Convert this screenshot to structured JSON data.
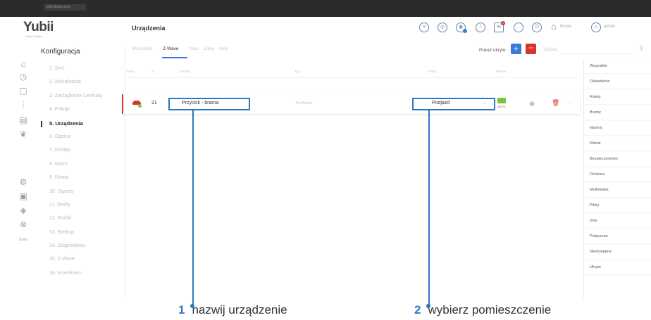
{
  "browser": {
    "url": "skm.fibaro.com"
  },
  "app": {
    "logo": "Yubii",
    "logo_sub": "Home Center",
    "brand_color": "#3a7bd5",
    "danger_color": "#d9342b"
  },
  "sidebar": {
    "title": "Konfiguracja",
    "items": [
      {
        "label": "1. Sieć"
      },
      {
        "label": "2. Aktualizacja"
      },
      {
        "label": "3. Zarządzanie Centralą"
      },
      {
        "label": "4. Pokoje"
      },
      {
        "label": "5. Urządzenia",
        "active": true
      },
      {
        "label": "6. Ogólne"
      },
      {
        "label": "7. Dostęp"
      },
      {
        "label": "8. Alarm"
      },
      {
        "label": "9. Klimat"
      },
      {
        "label": "10. Ogrody"
      },
      {
        "label": "11. Strefy"
      },
      {
        "label": "12. Profile"
      },
      {
        "label": "13. Backup"
      },
      {
        "label": "14. Diagnostyka"
      },
      {
        "label": "15. Z-Wave"
      },
      {
        "label": "16. Incentiveru"
      }
    ],
    "rail_icons": [
      "home-icon",
      "clock-icon",
      "panel-icon",
      "chart-icon",
      "grid-icon",
      "leaf-icon",
      "gear-icon",
      "window-icon",
      "shield-icon",
      "settings-icon",
      "user-icon"
    ],
    "rail_footer": "Szary"
  },
  "header": {
    "title": "Urządzenia",
    "home_label": "Home",
    "user_label": "admin",
    "notification_count": "1"
  },
  "tabs": [
    "Wszystkie",
    "Z-Wave",
    "Nice",
    "Zony",
    "Inne"
  ],
  "toolbar": {
    "show_hidden": "Pokaż ukryte",
    "add_label": "+",
    "delete_label": "−",
    "search_label": "Szukaj"
  },
  "columns": [
    "Ikona",
    "ID",
    "Nazwa",
    "Typ",
    "Pokój",
    "Bateria"
  ],
  "row": {
    "id": "21",
    "name": "Przycisk - brama",
    "type": "The Button",
    "room": "Podjazd",
    "battery": "100 %"
  },
  "filters": [
    "Wszystkie",
    "Oświetlenie",
    "Rolety",
    "Bramy",
    "Nastroj",
    "Klimat",
    "Bezpieczeństwo",
    "Ochrona",
    "Multimedia",
    "Piloty",
    "Inne",
    "Połączone",
    "Niedostępne",
    "Ukryte"
  ],
  "callouts": [
    {
      "num": "1",
      "text": "nazwij urządzenie"
    },
    {
      "num": "2",
      "text": "wybierz pomieszczenie"
    }
  ]
}
